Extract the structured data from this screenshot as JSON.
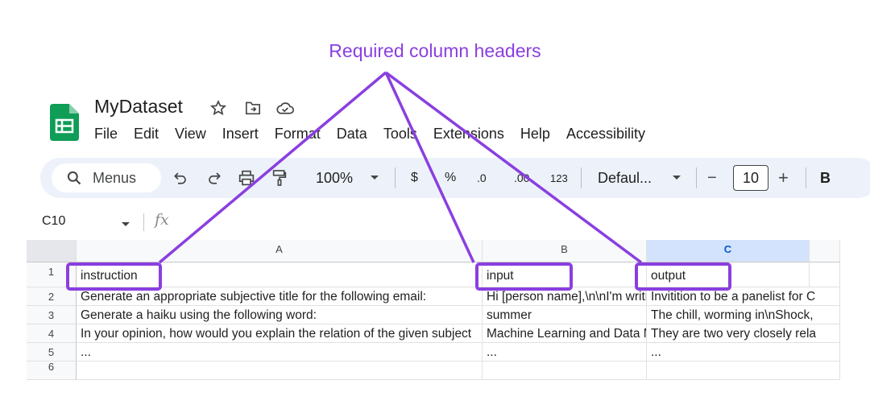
{
  "annotation": {
    "title": "Required column headers",
    "color": "#8a3fe0"
  },
  "app": {
    "doc_title": "MyDataset",
    "menu": [
      "File",
      "Edit",
      "View",
      "Insert",
      "Format",
      "Data",
      "Tools",
      "Extensions",
      "Help",
      "Accessibility"
    ],
    "brand_color": "#0f9d58"
  },
  "toolbar": {
    "menus_label": "Menus",
    "zoom": "100%",
    "currency": "$",
    "percent": "%",
    "dec_decrease": ".0",
    "dec_increase": ".00",
    "number_format": "123",
    "font": "Defaul...",
    "minus": "−",
    "font_size": "10",
    "plus": "+",
    "bold": "B"
  },
  "formula_bar": {
    "cell_ref": "C10",
    "fx": "fx"
  },
  "sheet": {
    "selected_column": "C",
    "columns": [
      "A",
      "B",
      "C"
    ],
    "row_numbers": [
      "1",
      "2",
      "3",
      "4",
      "5",
      "6"
    ],
    "rows": [
      [
        "instruction",
        "input",
        "output"
      ],
      [
        "Generate an appropriate subjective title for the following email:",
        "Hi [person name],\\n\\nI'm writing",
        "Invitition to be a panelist for C"
      ],
      [
        "Generate a haiku using the following word:",
        "summer",
        "The chill, worming in\\nShock,"
      ],
      [
        "In your opinion, how would you explain the relation of the given subject",
        "Machine Learning and Data Mining",
        "They are two very closely rela"
      ],
      [
        "...",
        "...",
        "..."
      ]
    ]
  }
}
